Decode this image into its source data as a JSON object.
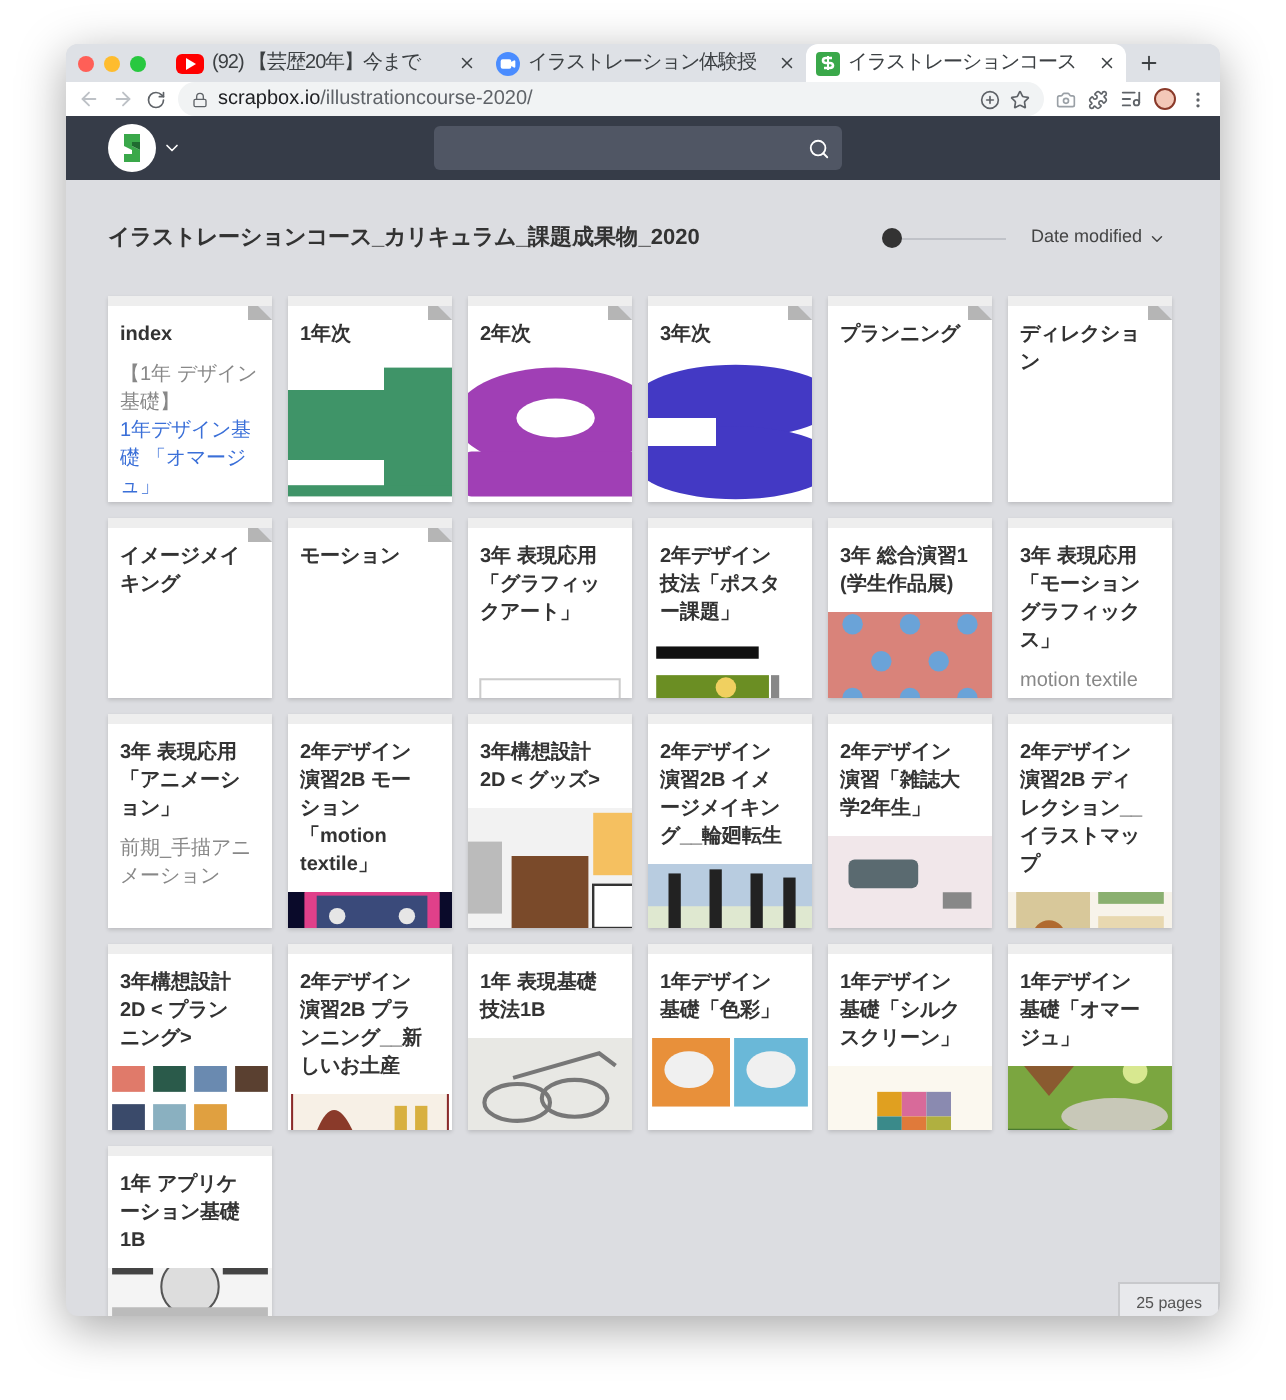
{
  "tabs": [
    {
      "title": "(92) 【芸歴20年】今まで",
      "selected": false
    },
    {
      "title": "イラストレーション体験授",
      "selected": false
    },
    {
      "title": "イラストレーションコース",
      "selected": true
    }
  ],
  "address": {
    "host": "scrapbox.io",
    "path": "/illustrationcourse-2020/"
  },
  "project": {
    "title": "イラストレーションコース_カリキュラム_課題成果物_2020",
    "slider": {
      "level": 0
    },
    "sort": "Date modified"
  },
  "pages": [
    {
      "title": "index",
      "folded": true,
      "image": false,
      "snippets": [
        {
          "text": "【1年 デザイン基礎】",
          "kind": "plain"
        },
        {
          "text": "1年デザイン基礎 「オマージュ」",
          "kind": "link"
        }
      ]
    },
    {
      "title": "1年次",
      "folded": true,
      "image": true
    },
    {
      "title": "2年次",
      "folded": true,
      "image": true
    },
    {
      "title": "3年次",
      "folded": true,
      "image": true
    },
    {
      "title": "プランニング",
      "folded": true,
      "image": false
    },
    {
      "title": "ディレクション",
      "folded": true,
      "image": false
    },
    {
      "title": "イメージメイキング",
      "folded": true,
      "image": false
    },
    {
      "title": "モーション",
      "folded": true,
      "image": false
    },
    {
      "title": "3年 表現応用「グラフィックアート」",
      "folded": false,
      "image": true
    },
    {
      "title": "2年デザイン技法「ポスター課題」",
      "folded": false,
      "image": true
    },
    {
      "title": "3年 総合演習1 (学生作品展)",
      "folded": false,
      "image": true
    },
    {
      "title": "3年 表現応用「モーショングラフィックス」",
      "folded": false,
      "image": false,
      "snippets": [
        {
          "text": "motion textile",
          "kind": "plain"
        }
      ]
    },
    {
      "title": "3年 表現応用「アニメーション」",
      "folded": false,
      "image": false,
      "snippets": [
        {
          "text": "前期_手描アニメーション",
          "kind": "plain"
        }
      ]
    },
    {
      "title": "2年デザイン演習2B モーション「motion textile」",
      "folded": false,
      "image": true
    },
    {
      "title": "3年構想設計2D < グッズ>",
      "folded": false,
      "image": true
    },
    {
      "title": "2年デザイン演習2B イメージメイキング__輪廻転生",
      "folded": false,
      "image": true
    },
    {
      "title": "2年デザイン演習「雑誌大学2年生」",
      "folded": false,
      "image": true
    },
    {
      "title": "2年デザイン演習2B ディレクション__イラストマップ",
      "folded": false,
      "image": true
    },
    {
      "title": "3年構想設計2D < プランニング>",
      "folded": false,
      "image": true
    },
    {
      "title": "2年デザイン演習2B プランニング__新しいお土産",
      "folded": false,
      "image": true
    },
    {
      "title": "1年 表現基礎技法1B",
      "folded": false,
      "image": true
    },
    {
      "title": "1年デザイン基礎「色彩」",
      "folded": false,
      "image": true
    },
    {
      "title": "1年デザイン基礎「シルクスクリーン」",
      "folded": false,
      "image": true
    },
    {
      "title": "1年デザイン基礎「オマージュ」",
      "folded": false,
      "image": true
    },
    {
      "title": "1年 アプリケーション基礎1B",
      "folded": false,
      "image": true
    }
  ],
  "footer": {
    "count": "25 pages"
  }
}
